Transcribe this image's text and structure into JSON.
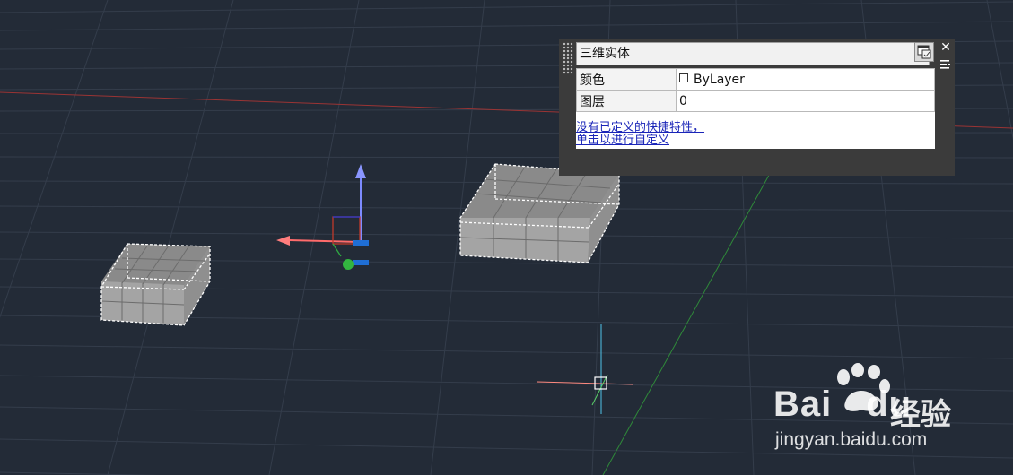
{
  "viewport": {
    "background": "#232b37",
    "grid_color": "#3a4352",
    "x_axis_color": "#a83a3a",
    "y_axis_color": "#2f8a3a"
  },
  "quick_properties": {
    "object_type": "三维实体",
    "rows": [
      {
        "name": "颜色",
        "value": "ByLayer",
        "has_swatch": true
      },
      {
        "name": "图层",
        "value": "0",
        "has_swatch": false
      }
    ],
    "link_line1": "没有已定义的快捷特性，",
    "link_line2": "单击以进行自定义",
    "close_symbol": "✕",
    "dropdown_icon": "chevron-down-icon"
  },
  "watermark": {
    "brand": "Bai",
    "brand2": "du",
    "cn": "经验",
    "url": "jingyan.baidu.com"
  }
}
